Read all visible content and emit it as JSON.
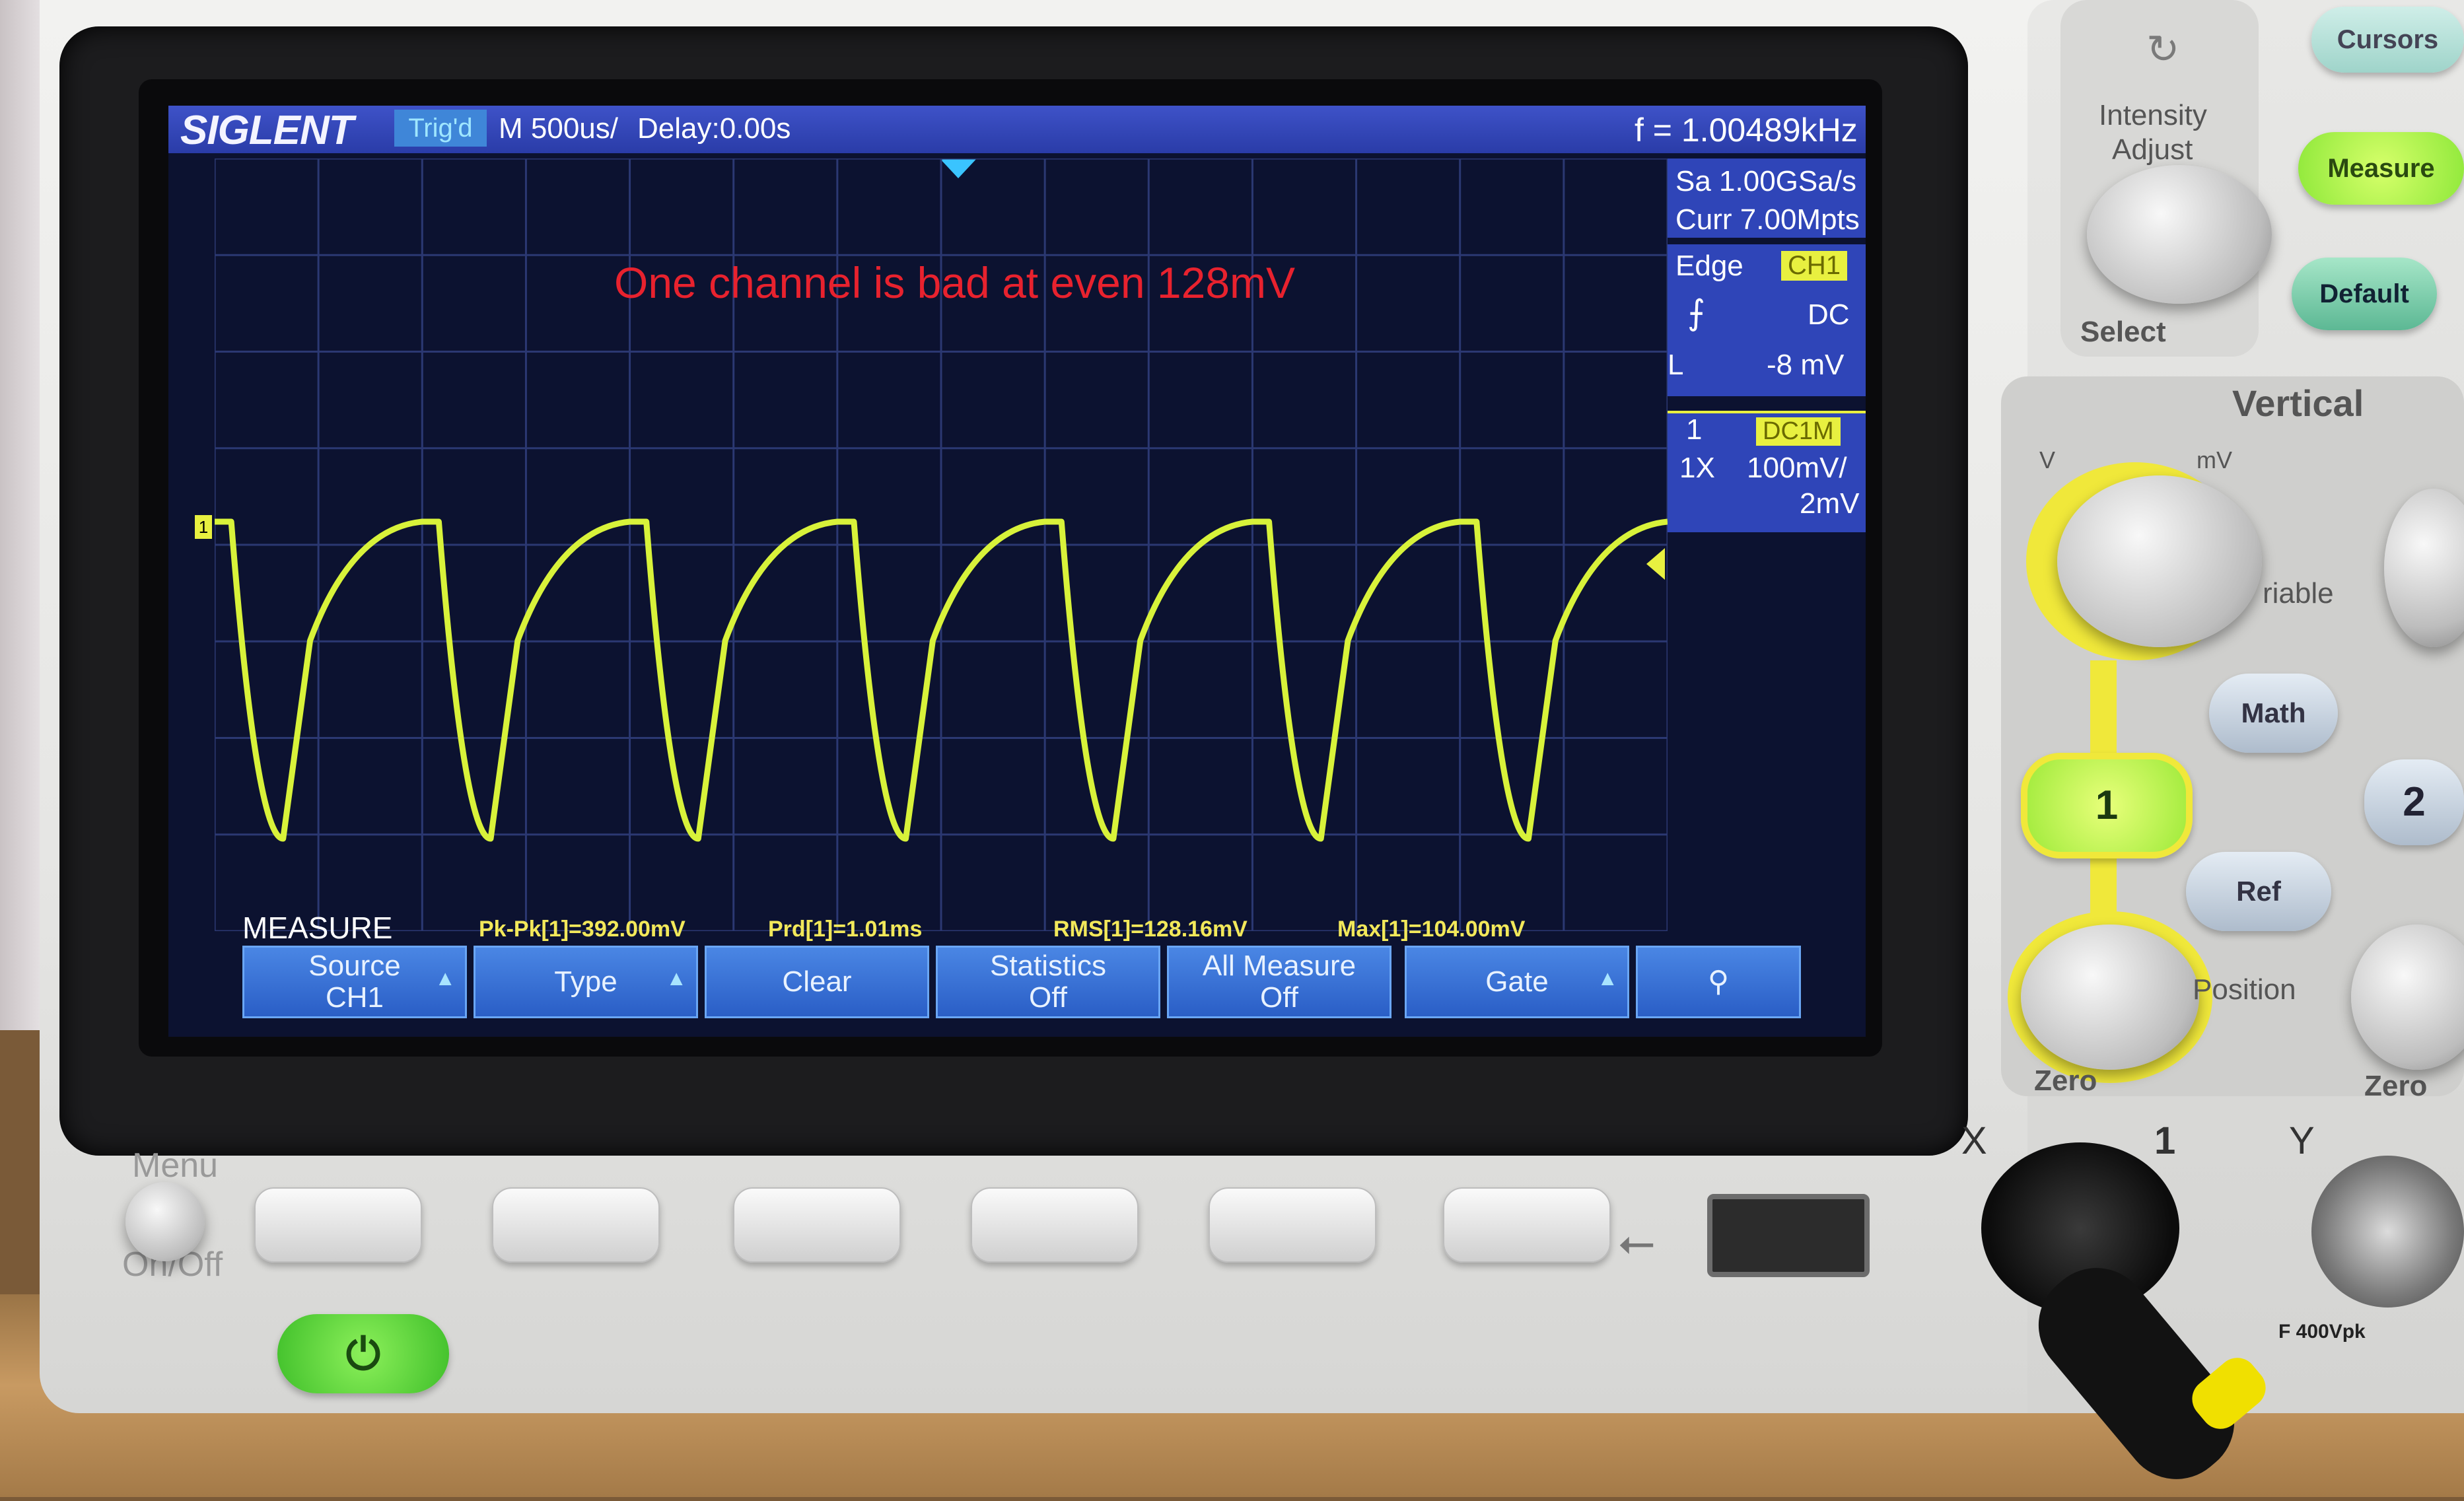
{
  "screen": {
    "brand": "SIGLENT",
    "trigger_status": "Trig'd",
    "timebase": "M 500us/",
    "delay": "Delay:0.00s",
    "frequency": "f = 1.00489kHz",
    "sample_rate": "Sa 1.00GSa/s",
    "memory": "Curr 7.00Mpts",
    "trigger": {
      "type": "Edge",
      "source": "CH1",
      "slope_icon": "rising-edge-icon",
      "coupling": "DC",
      "level_prefix": "L",
      "level": "-8 mV"
    },
    "channel": {
      "number": "1",
      "coupling": "DC1M",
      "probe": "1X",
      "scale": "100mV/",
      "offset": "2mV"
    },
    "channel_marker": "1",
    "annotation": "One channel is bad at even 128mV",
    "measure_title": "MEASURE",
    "measurements": [
      "Pk-Pk[1]=392.00mV",
      "Prd[1]=1.01ms",
      "RMS[1]=128.16mV",
      "Max[1]=104.00mV"
    ],
    "softkeys": [
      {
        "line1": "Source",
        "line2": "CH1"
      },
      {
        "line1": "Type",
        "line2": ""
      },
      {
        "line1": "Clear",
        "line2": ""
      },
      {
        "line1": "Statistics",
        "line2": "Off"
      },
      {
        "line1": "All Measure",
        "line2": "Off"
      },
      {
        "line1": "Gate",
        "line2": ""
      }
    ],
    "waveform_color": "#d8f23a",
    "waveform_cycles": 7
  },
  "panel": {
    "menu_label": "Menu",
    "onoff_label": "On/Off",
    "intensity_label": "Intensity",
    "adjust_label": "Adjust",
    "select_label": "Select",
    "cursors_label": "Cursors",
    "measure_label": "Measure",
    "default_label": "Default",
    "vertical_label": "Vertical",
    "v_label": "V",
    "mv_label": "mV",
    "variable_label": "riable",
    "math_label": "Math",
    "ch1_label": "1",
    "ch2_label": "2",
    "ref_label": "Ref",
    "position_label": "Position",
    "zero_label": "Zero",
    "zero_label_2": "Zero",
    "x_label": "X",
    "one_label": "1",
    "y_label": "Y",
    "rating_label": "F 400Vpk"
  }
}
